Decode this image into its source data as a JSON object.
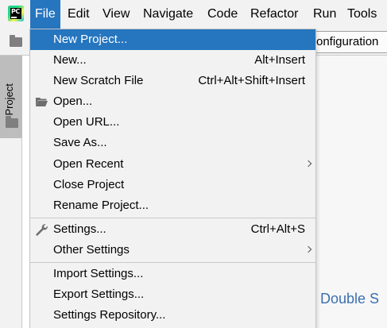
{
  "menubar": {
    "items": [
      {
        "label": "File",
        "mnemonic": "F"
      },
      {
        "label": "Edit",
        "mnemonic": "E"
      },
      {
        "label": "View",
        "mnemonic": "V"
      },
      {
        "label": "Navigate",
        "mnemonic": "N"
      },
      {
        "label": "Code",
        "mnemonic": "C"
      },
      {
        "label": "Refactor",
        "mnemonic": "R"
      },
      {
        "label": "Run",
        "mnemonic": "u"
      },
      {
        "label": "Tools",
        "mnemonic": "T"
      }
    ],
    "active": "File"
  },
  "toolbar": {
    "configuration_button": "onfiguration"
  },
  "side_panel": {
    "tab_label": "1: Project"
  },
  "editor": {
    "hint_text": "e Double S"
  },
  "file_menu": {
    "items": [
      {
        "label": "New Project...",
        "shortcut": "",
        "submenu": false,
        "highlighted": true
      },
      {
        "label": "New...",
        "shortcut": "Alt+Insert",
        "submenu": false
      },
      {
        "label": "New Scratch File",
        "shortcut": "Ctrl+Alt+Shift+Insert",
        "submenu": false
      },
      {
        "label": "Open...",
        "shortcut": "",
        "submenu": false,
        "icon": "folder-open-icon"
      },
      {
        "label": "Open URL...",
        "shortcut": "",
        "submenu": false
      },
      {
        "label": "Save As...",
        "shortcut": "",
        "submenu": false
      },
      {
        "label": "Open Recent",
        "shortcut": "",
        "submenu": true
      },
      {
        "label": "Close Project",
        "shortcut": "",
        "submenu": false
      },
      {
        "label": "Rename Project...",
        "shortcut": "",
        "submenu": false
      },
      {
        "label": "Settings...",
        "shortcut": "Ctrl+Alt+S",
        "submenu": false,
        "icon": "wrench-icon"
      },
      {
        "label": "Other Settings",
        "shortcut": "",
        "submenu": true
      },
      {
        "label": "Import Settings...",
        "shortcut": "",
        "submenu": false
      },
      {
        "label": "Export Settings...",
        "shortcut": "",
        "submenu": false
      },
      {
        "label": "Settings Repository...",
        "shortcut": "",
        "submenu": false
      }
    ]
  },
  "colors": {
    "menu_highlight": "#2675bf",
    "background": "#f2f2f2",
    "hint_text": "#3b6fb0"
  }
}
